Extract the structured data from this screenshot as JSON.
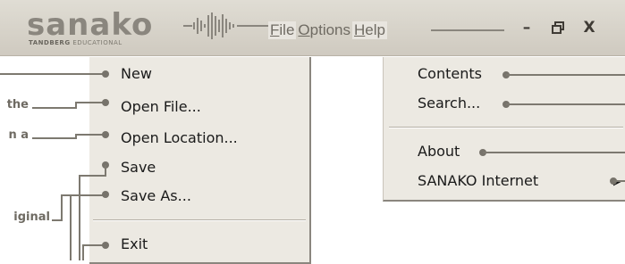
{
  "logo": {
    "word": "sanako",
    "sub_bold": "TANDBERG",
    "sub_rest": "EDUCATIONAL"
  },
  "menubar": {
    "file": {
      "mnemonic": "F",
      "rest": "ile"
    },
    "options": {
      "mnemonic": "O",
      "rest": "ptions"
    },
    "help": {
      "mnemonic": "H",
      "rest": "elp"
    }
  },
  "window_buttons": {
    "minimize": "–",
    "restore": "🗗",
    "close": "X"
  },
  "file_menu": {
    "items": [
      {
        "label": "New"
      },
      {
        "label": "Open File..."
      },
      {
        "label": "Open Location..."
      },
      {
        "label": "Save"
      },
      {
        "label": "Save As..."
      },
      {
        "label": "Exit"
      }
    ]
  },
  "help_menu": {
    "items": [
      {
        "label": "Contents"
      },
      {
        "label": "Search..."
      },
      {
        "label": "About"
      },
      {
        "label": "SANAKO Internet"
      }
    ],
    "submenu_arrow": "▶"
  },
  "annotations": {
    "open_file": "the",
    "open_location": "n a",
    "save_as": "iginal"
  },
  "colors": {
    "titlebar": "#d8d4cb",
    "menu_bg": "#ece9e2",
    "callout": "#7d7970"
  }
}
